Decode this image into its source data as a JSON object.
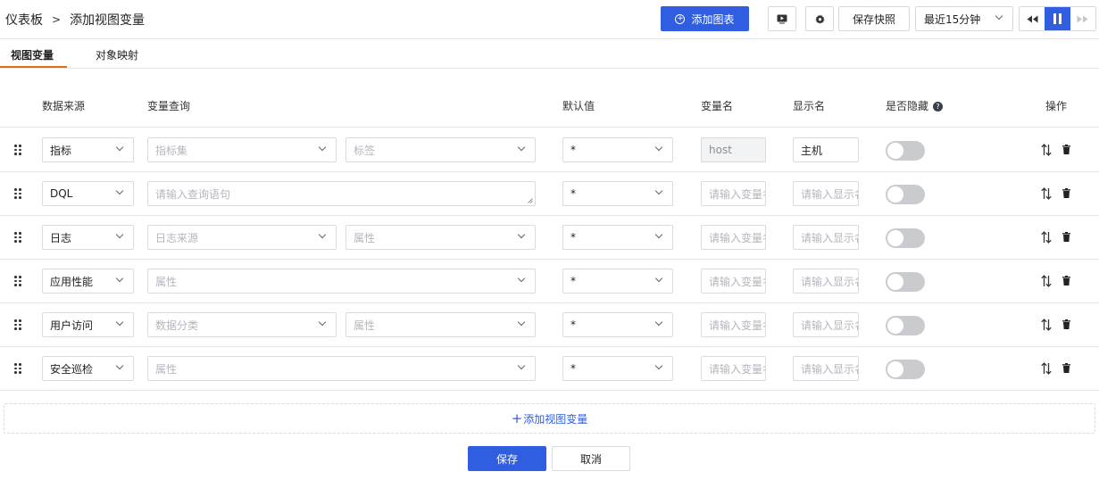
{
  "breadcrumb": {
    "root": "仪表板",
    "current": "添加视图变量"
  },
  "toolbar": {
    "add_chart": "添加图表",
    "save_snapshot": "保存快照",
    "time_range": "最近15分钟"
  },
  "tabs": [
    {
      "label": "视图变量",
      "active": true
    },
    {
      "label": "对象映射",
      "active": false
    }
  ],
  "columns": {
    "source": "数据来源",
    "query": "变量查询",
    "default": "默认值",
    "var_name": "变量名",
    "display_name": "显示名",
    "hidden": "是否隐藏",
    "action": "操作"
  },
  "rows": [
    {
      "source": "指标",
      "query1": "指标集",
      "query2": "标签",
      "default": "*",
      "var_name": "host",
      "var_name_disabled": true,
      "display_name": "主机",
      "hidden": false
    },
    {
      "source": "DQL",
      "query_full": "请输入查询语句",
      "default": "*",
      "var_name_placeholder": "请输入变量名",
      "display_name_placeholder": "请输入显示名",
      "hidden": false
    },
    {
      "source": "日志",
      "query1": "日志来源",
      "query2": "属性",
      "default": "*",
      "var_name_placeholder": "请输入变量名",
      "display_name_placeholder": "请输入显示名",
      "hidden": false
    },
    {
      "source": "应用性能",
      "query_full": "属性",
      "default": "*",
      "var_name_placeholder": "请输入变量名",
      "display_name_placeholder": "请输入显示名",
      "hidden": false
    },
    {
      "source": "用户访问",
      "query1": "数据分类",
      "query2": "属性",
      "default": "*",
      "var_name_placeholder": "请输入变量名",
      "display_name_placeholder": "请输入显示名",
      "hidden": false
    },
    {
      "source": "安全巡检",
      "query_full": "属性",
      "default": "*",
      "var_name_placeholder": "请输入变量名",
      "display_name_placeholder": "请输入显示名",
      "hidden": false
    }
  ],
  "add_variable": "添加视图变量",
  "footer": {
    "save": "保存",
    "cancel": "取消"
  },
  "colors": {
    "primary": "#2f5ee0",
    "tab_accent": "#e36f16",
    "toggle_off": "#c9cbcf"
  }
}
